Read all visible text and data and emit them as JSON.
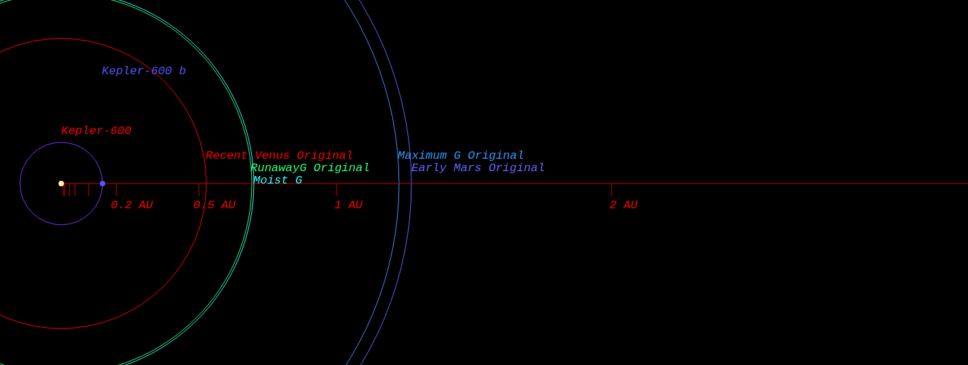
{
  "star": {
    "name": "Kepler-600"
  },
  "planets": [
    {
      "name": "Kepler-600 b",
      "color": "#5555ff"
    }
  ],
  "zones": [
    {
      "label": "Recent Venus Original",
      "color": "#ff0000"
    },
    {
      "label": "RunawayG Original",
      "color": "#33ff77"
    },
    {
      "label": "Moist G",
      "color": "#33ffff"
    },
    {
      "label": "Maximum G Original",
      "color": "#3399ff"
    },
    {
      "label": "Early Mars Original",
      "color": "#6666ff"
    }
  ],
  "axis": {
    "tick_labels": [
      "0.2 AU",
      "0.5 AU",
      "1 AU",
      "2 AU"
    ]
  }
}
